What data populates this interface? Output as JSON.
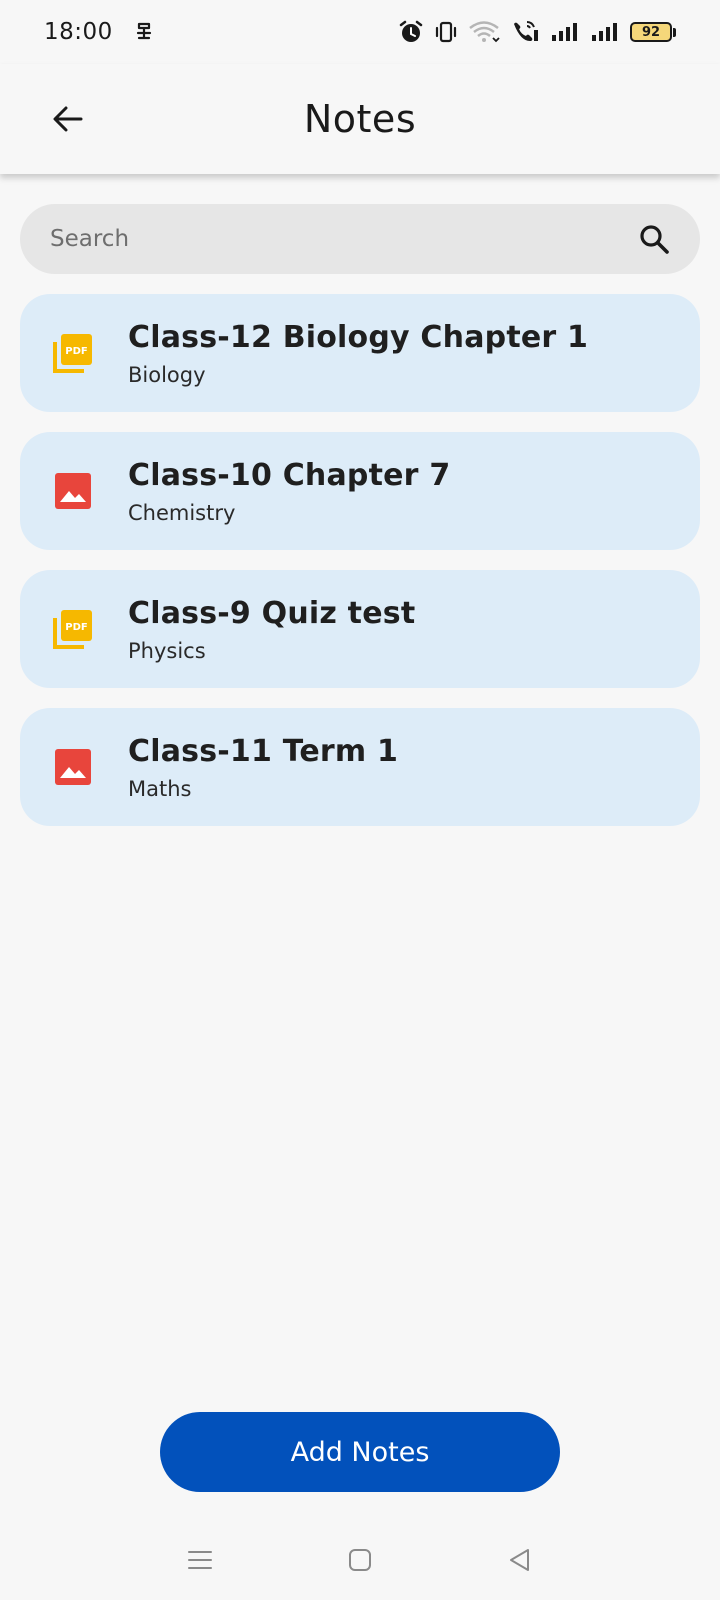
{
  "status_bar": {
    "time": "18:00",
    "battery_level": "92",
    "icons": [
      "notification-icon",
      "alarm-icon",
      "vibrate-icon",
      "wifi-icon",
      "wifi-call-icon",
      "signal-icon",
      "signal-icon",
      "battery-icon"
    ]
  },
  "app_bar": {
    "title": "Notes",
    "back_icon": "arrow-back-icon"
  },
  "search": {
    "placeholder": "Search",
    "value": "",
    "icon": "search-icon"
  },
  "notes": [
    {
      "title": "Class-12 Biology Chapter 1",
      "subject": "Biology",
      "type": "pdf",
      "icon": "pdf-icon"
    },
    {
      "title": "Class-10 Chapter 7",
      "subject": "Chemistry",
      "type": "image",
      "icon": "image-icon"
    },
    {
      "title": "Class-9 Quiz test",
      "subject": "Physics",
      "type": "pdf",
      "icon": "pdf-icon"
    },
    {
      "title": "Class-11 Term 1",
      "subject": "Maths",
      "type": "image",
      "icon": "image-icon"
    }
  ],
  "actions": {
    "add_label": "Add Notes"
  },
  "nav_bar": {
    "items": [
      "menu-icon",
      "home-icon",
      "back-icon"
    ]
  },
  "colors": {
    "accent": "#0251bb",
    "card_background": "#ddecf8",
    "pdf_icon": "#f6b800",
    "image_icon": "#e8453c",
    "search_background": "#e6e6e6",
    "battery_fill": "#f5d77a"
  }
}
